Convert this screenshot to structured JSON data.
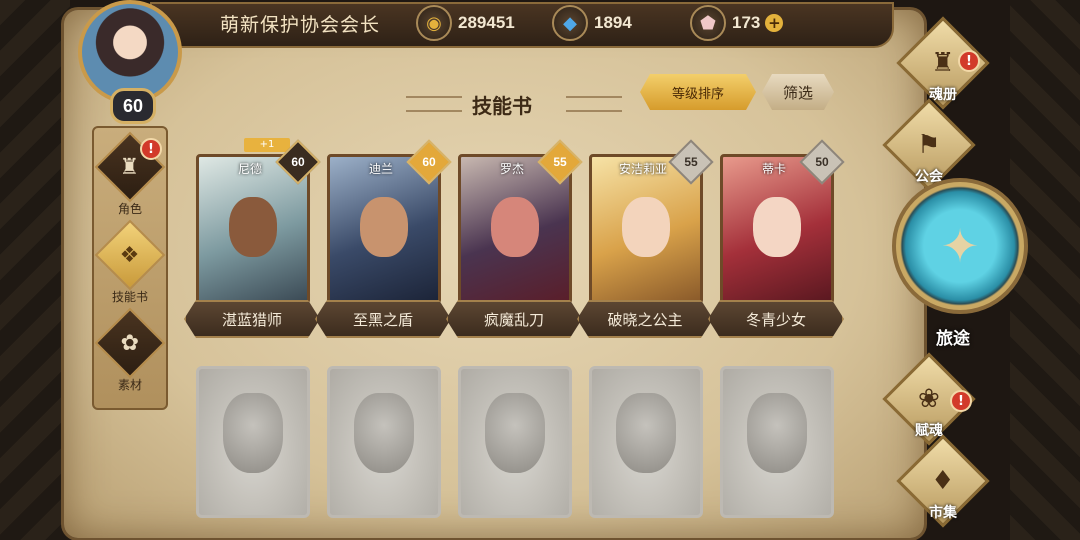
{
  "header": {
    "player_name": "萌新保护协会会长",
    "gold": "289451",
    "crystal": "1894",
    "gem": "173"
  },
  "avatar": {
    "level": "60"
  },
  "left_nav": [
    {
      "label": "角色",
      "alert": "!"
    },
    {
      "label": "技能书",
      "active": true
    },
    {
      "label": "素材"
    }
  ],
  "page": {
    "title": "技能书",
    "sort_button": "等级排序",
    "filter_button": "筛选"
  },
  "cards": [
    {
      "hero": "尼德",
      "level": "60",
      "skill": "湛蓝猎师",
      "bonus": "+1"
    },
    {
      "hero": "迪兰",
      "level": "60",
      "skill": "至黑之盾"
    },
    {
      "hero": "罗杰",
      "level": "55",
      "skill": "疯魔乱刀"
    },
    {
      "hero": "安洁莉亚",
      "level": "55",
      "skill": "破晓之公主"
    },
    {
      "hero": "蒂卡",
      "level": "50",
      "skill": "冬青少女"
    }
  ],
  "right_nav": {
    "book": "魂册",
    "guild": "公会",
    "journey": "旅途",
    "soul": "赋魂",
    "market": "市集"
  }
}
